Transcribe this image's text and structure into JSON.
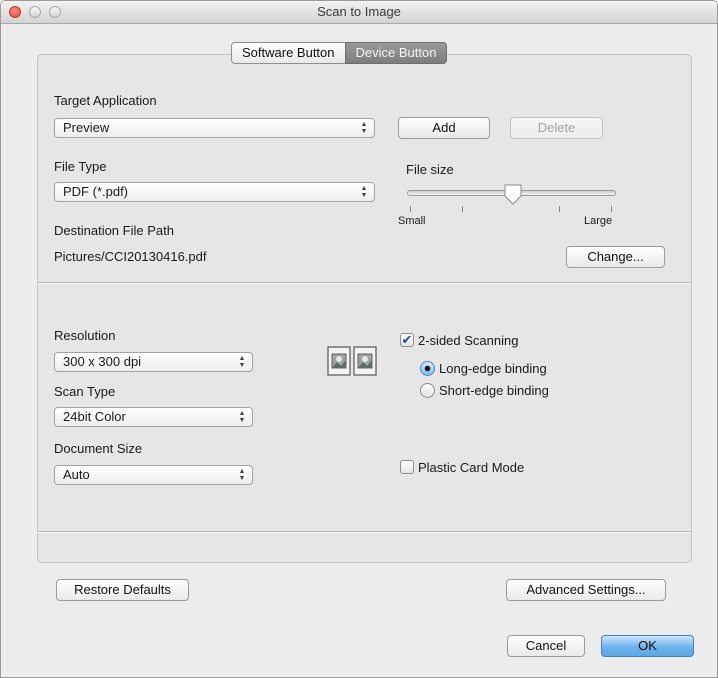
{
  "window": {
    "title": "Scan to Image"
  },
  "tabs": [
    {
      "label": "Software Button",
      "selected": false
    },
    {
      "label": "Device Button",
      "selected": true
    }
  ],
  "target_application": {
    "label": "Target Application",
    "value": "Preview",
    "add_button": "Add",
    "delete_button": "Delete"
  },
  "file_type": {
    "label": "File Type",
    "value": "PDF (*.pdf)"
  },
  "file_size": {
    "label": "File size",
    "min_label": "Small",
    "max_label": "Large",
    "level_fraction": 0.5
  },
  "destination": {
    "label": "Destination File Path",
    "path": "Pictures/CCI20130416.pdf",
    "change_button": "Change..."
  },
  "resolution": {
    "label": "Resolution",
    "value": "300 x 300 dpi"
  },
  "scan_type": {
    "label": "Scan Type",
    "value": "24bit Color"
  },
  "document_size": {
    "label": "Document Size",
    "value": "Auto"
  },
  "two_sided": {
    "label": "2-sided Scanning",
    "checked": true,
    "options": [
      {
        "label": "Long-edge binding",
        "selected": true
      },
      {
        "label": "Short-edge binding",
        "selected": false
      }
    ]
  },
  "plastic_card": {
    "label": "Plastic Card Mode",
    "checked": false
  },
  "footer": {
    "restore_defaults": "Restore Defaults",
    "advanced_settings": "Advanced Settings...",
    "cancel": "Cancel",
    "ok": "OK"
  },
  "icons": {
    "checkmark": "✔",
    "popup_arrows": "▲▼",
    "duplex": "duplex-scan-icon"
  },
  "colors": {
    "default_button": "#5aa7e6",
    "selected_tab": "#8a8a8a"
  }
}
